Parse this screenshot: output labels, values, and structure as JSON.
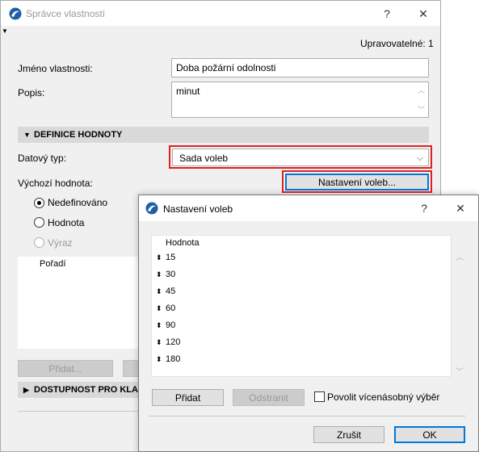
{
  "main_window": {
    "title": "Správce vlastností",
    "help_label": "?",
    "close_label": "✕",
    "editable_count": "Upravovatelné: 1",
    "name_label": "Jméno vlastnosti:",
    "name_value": "Doba požární odolnosti",
    "description_label": "Popis:",
    "description_value": "minut",
    "section_definition": "DEFINICE HODNOTY",
    "data_type_label": "Datový typ:",
    "data_type_value": "Sada voleb",
    "default_value_label": "Výchozí hodnota:",
    "options_settings_button": "Nastavení voleb...",
    "radio_undefined": "Nedefinováno",
    "radio_value": "Hodnota",
    "radio_expression": "Výraz",
    "order_header": "Pořadí",
    "add_button": "Přidat...",
    "section_availability": "DOSTUPNOST PRO KLASI"
  },
  "dialog": {
    "title": "Nastavení voleb",
    "help_label": "?",
    "close_label": "✕",
    "list_header": "Hodnota",
    "values": [
      "15",
      "30",
      "45",
      "60",
      "90",
      "120",
      "180"
    ],
    "add_button": "Přidat",
    "remove_button": "Odstranit",
    "allow_multiple_label": "Povolit vícenásobný výběr",
    "cancel_button": "Zrušit",
    "ok_button": "OK"
  },
  "colors": {
    "highlight_red": "#e02020",
    "focus_blue": "#0078d7",
    "section_gray": "#d9d9d9"
  }
}
